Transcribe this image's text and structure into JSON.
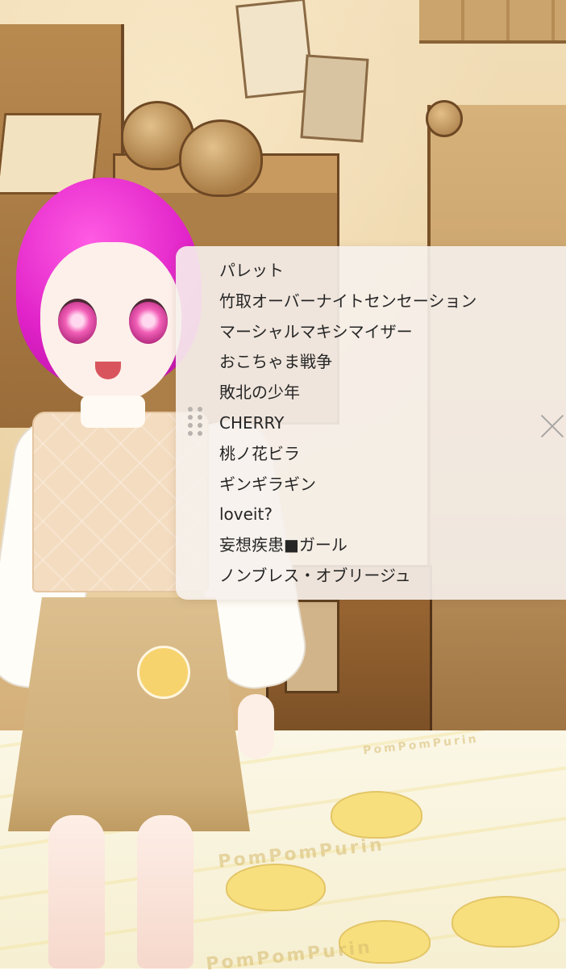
{
  "playlist": {
    "songs": [
      "パレット",
      "竹取オーバーナイトセンセーション",
      "マーシャルマキシマイザー",
      "おこちゃま戦争",
      "敗北の少年",
      "CHERRY",
      "桃ノ花ビラ",
      "ギンギラギン",
      "loveit?",
      "妄想疾患■ガール",
      "ノンブレス・オブリージュ"
    ],
    "icons": {
      "drag": "drag-handle-icon",
      "close": "close-icon"
    }
  },
  "background": {
    "floor_print": [
      "PomPomPurin",
      "PomPomPurin",
      "PomPomPurin"
    ]
  },
  "colors": {
    "hair": "#e022c8",
    "panel": "#f6f1ec",
    "text": "#262626"
  }
}
